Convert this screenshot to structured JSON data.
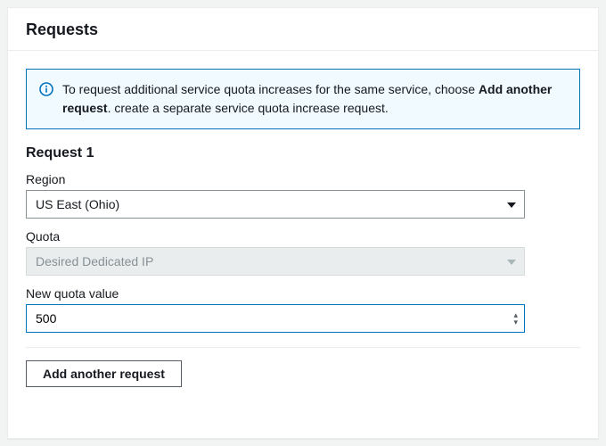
{
  "panel": {
    "title": "Requests"
  },
  "info": {
    "text_prefix": "To request additional service quota increases for the same service, choose ",
    "bold": "Add another request",
    "text_suffix": ". create a separate service quota increase request."
  },
  "request": {
    "title": "Request 1",
    "region_label": "Region",
    "region_value": "US East (Ohio)",
    "quota_label": "Quota",
    "quota_value": "Desired Dedicated IP",
    "new_value_label": "New quota value",
    "new_value": "500"
  },
  "actions": {
    "add_another": "Add another request"
  }
}
